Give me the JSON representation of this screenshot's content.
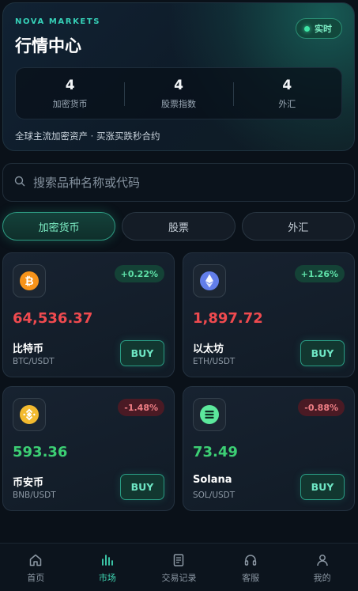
{
  "header": {
    "brand": "NOVA MARKETS",
    "title": "行情中心",
    "live_label": "实时",
    "stats": [
      {
        "value": "4",
        "label": "加密货币"
      },
      {
        "value": "4",
        "label": "股票指数"
      },
      {
        "value": "4",
        "label": "外汇"
      }
    ],
    "subtitle": "全球主流加密资产 · 买涨买跌秒合约"
  },
  "search": {
    "placeholder": "搜索品种名称或代码",
    "icon": "search-icon"
  },
  "tabs": [
    {
      "label": "加密货币",
      "active": true
    },
    {
      "label": "股票",
      "active": false
    },
    {
      "label": "外汇",
      "active": false
    }
  ],
  "cards": [
    {
      "icon": "bitcoin-icon",
      "change": "+0.22%",
      "trend": "up",
      "price": "64,536.37",
      "price_color": "#ef4a4f",
      "name": "比特币",
      "pair": "BTC/USDT",
      "buy_label": "BUY"
    },
    {
      "icon": "ethereum-icon",
      "change": "+1.26%",
      "trend": "up",
      "price": "1,897.72",
      "price_color": "#ef4a4f",
      "name": "以太坊",
      "pair": "ETH/USDT",
      "buy_label": "BUY"
    },
    {
      "icon": "binance-icon",
      "change": "-1.48%",
      "trend": "down",
      "price": "593.36",
      "price_color": "#3ccf74",
      "name": "币安币",
      "pair": "BNB/USDT",
      "buy_label": "BUY"
    },
    {
      "icon": "solana-icon",
      "change": "-0.88%",
      "trend": "down",
      "price": "73.49",
      "price_color": "#3ccf74",
      "name": "Solana",
      "pair": "SOL/USDT",
      "buy_label": "BUY"
    }
  ],
  "nav": [
    {
      "label": "首页",
      "icon": "home-icon",
      "active": false
    },
    {
      "label": "市场",
      "icon": "chart-bars-icon",
      "active": true
    },
    {
      "label": "交易记录",
      "icon": "document-icon",
      "active": false
    },
    {
      "label": "客服",
      "icon": "headset-icon",
      "active": false
    },
    {
      "label": "我的",
      "icon": "user-icon",
      "active": false
    }
  ],
  "colors": {
    "accent": "#36d1b8",
    "price_up_red": "#ef4a4f",
    "price_down_green": "#3ccf74"
  }
}
